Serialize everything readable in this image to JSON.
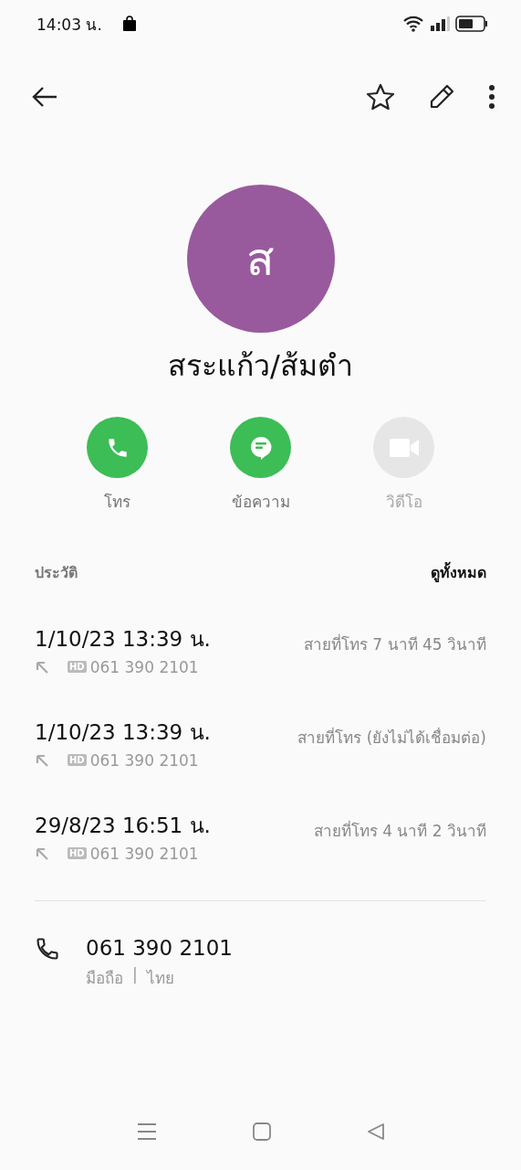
{
  "status_bar": {
    "time": "14:03 น."
  },
  "contact": {
    "initial": "ส",
    "name": "สระแก้ว/ส้มตำ"
  },
  "actions": [
    {
      "kind": "call",
      "label": "โทร",
      "disabled": false
    },
    {
      "kind": "message",
      "label": "ข้อความ",
      "disabled": false
    },
    {
      "kind": "video",
      "label": "วิดีโอ",
      "disabled": true
    }
  ],
  "history": {
    "title": "ประวัติ",
    "see_all": "ดูทั้งหมด",
    "entries": [
      {
        "datetime": "1/10/23 13:39 น.",
        "kind": "outgoing",
        "quality": "HD",
        "number": "061 390 2101",
        "detail": "สายที่โทร  7 นาที 45 วินาที"
      },
      {
        "datetime": "1/10/23 13:39 น.",
        "kind": "outgoing",
        "quality": "HD",
        "number": "061 390 2101",
        "detail": "สายที่โทร (ยังไม่ได้เชื่อมต่อ)"
      },
      {
        "datetime": "29/8/23 16:51 น.",
        "kind": "outgoing",
        "quality": "HD",
        "number": "061 390 2101",
        "detail": "สายที่โทร  4 นาที 2 วินาที"
      }
    ]
  },
  "phone": {
    "number": "061 390 2101",
    "type": "มือถือ",
    "separator": "|",
    "region": "ไทย"
  }
}
